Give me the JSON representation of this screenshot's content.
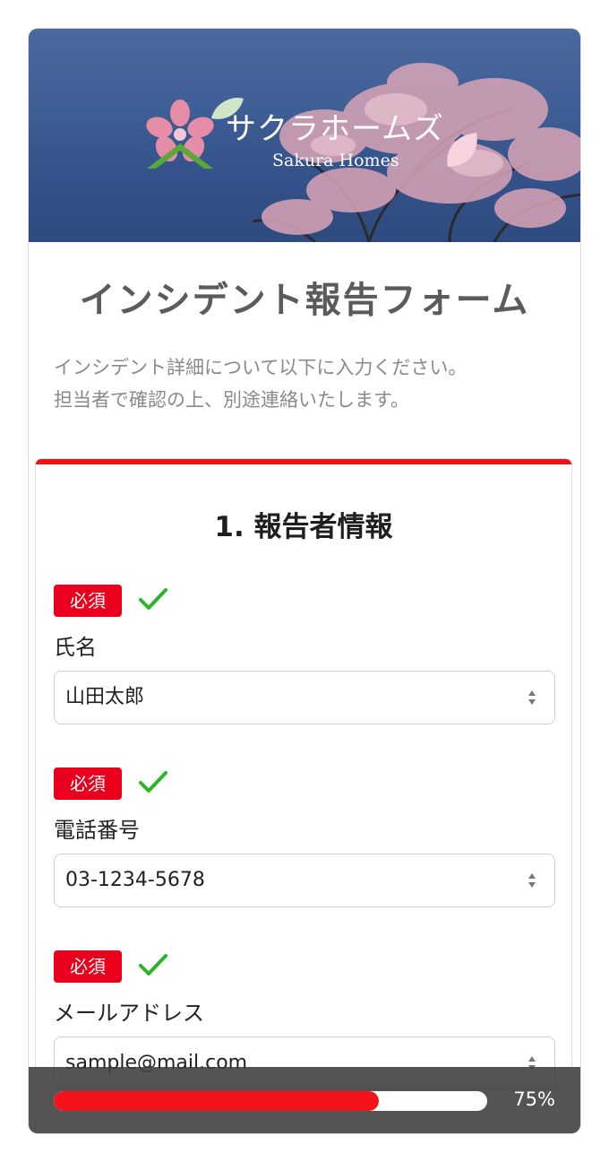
{
  "hero": {
    "brand_jp": "サクラホームズ",
    "brand_en": "Sakura Homes"
  },
  "form": {
    "title": "インシデント報告フォーム",
    "description_line1": "インシデント詳細について以下に入力ください。",
    "description_line2": "担当者で確認の上、別途連絡いたします。"
  },
  "section": {
    "title": "1. 報告者情報",
    "fields": [
      {
        "badge": "必須",
        "label": "氏名",
        "value": "山田太郎",
        "valid": true
      },
      {
        "badge": "必須",
        "label": "電話番号",
        "value": "03-1234-5678",
        "valid": true
      },
      {
        "badge": "必須",
        "label": "メールアドレス",
        "value": "sample@mail.com",
        "valid": true
      }
    ]
  },
  "progress": {
    "value": 0.75,
    "label": "75%"
  },
  "colors": {
    "accent": "#ec1515",
    "badge": "#e8001c",
    "check": "#2bb52b",
    "progress_fill": "#f4131a"
  },
  "icons": [
    "sakura-logo-icon",
    "check-icon",
    "spinner-arrows-icon"
  ]
}
